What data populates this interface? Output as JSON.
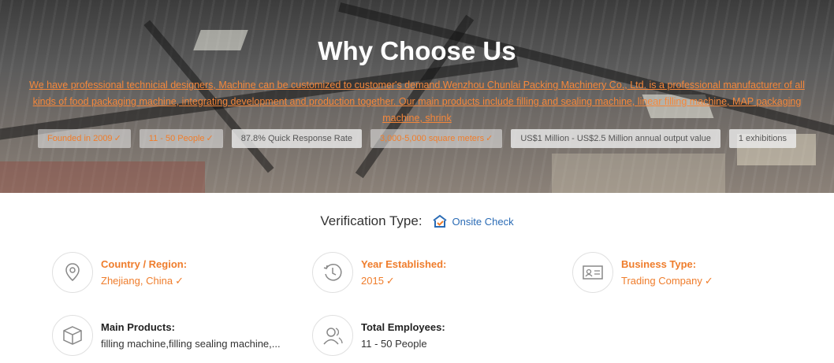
{
  "hero": {
    "title": "Why Choose Us",
    "description": "We have professional technicial designers, Machine can be customized to customer's demand.Wenzhou Chunlai Packing Machinery Co., Ltd. is a professional manufacturer of all kinds of food packaging machine, integrating development and production together. Our main products include filling and sealing machine, linear filling machine, MAP packaging machine, shrink",
    "badges": [
      {
        "text": "Founded in 2009",
        "verified": true
      },
      {
        "text": "11 - 50 People",
        "verified": true
      },
      {
        "text": "87.8% Quick Response Rate",
        "verified": false
      },
      {
        "text": "3,000-5,000 square meters",
        "verified": true
      },
      {
        "text": "US$1 Million - US$2.5 Million annual output value",
        "verified": false
      },
      {
        "text": "1 exhibitions",
        "verified": false
      }
    ]
  },
  "verification": {
    "label": "Verification Type:",
    "type": "Onsite Check"
  },
  "info": {
    "country_label": "Country / Region:",
    "country_value": "Zhejiang, China",
    "year_label": "Year Established:",
    "year_value": "2015",
    "business_label": "Business Type:",
    "business_value": "Trading Company",
    "products_label": "Main Products:",
    "products_value": "filling machine,filling sealing machine,...",
    "employees_label": "Total Employees:",
    "employees_value": "11 - 50 People"
  },
  "checkmark": "✓",
  "colors": {
    "accent": "#ef7d2c",
    "link": "#2a6bb5"
  }
}
